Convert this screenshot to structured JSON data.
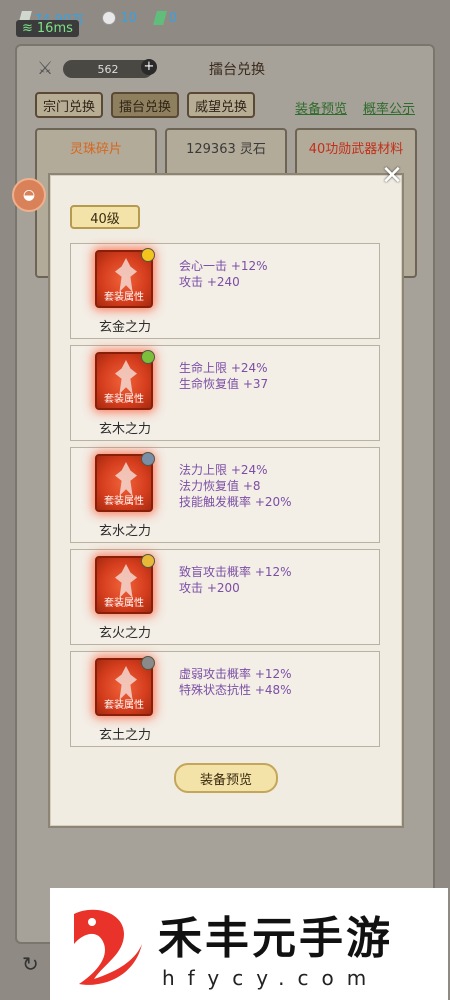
{
  "resources": {
    "spirit": "74.90万",
    "pearl": "10",
    "jade": "0",
    "ping": "16ms"
  },
  "panel": {
    "counter": "562",
    "title": "擂台兑换"
  },
  "tabs": [
    "宗门兑换",
    "擂台兑换",
    "威望兑换"
  ],
  "links": [
    "装备预览",
    "概率公示"
  ],
  "shop_cards": [
    "灵珠碎片",
    "129363 灵石",
    "40功勋武器材料"
  ],
  "modal": {
    "level": "40级",
    "sets": [
      {
        "name": "玄金之力",
        "badge_color": "#f2c41c",
        "attrs": [
          "会心一击 +12%",
          "攻击 +240"
        ]
      },
      {
        "name": "玄木之力",
        "badge_color": "#7bbf3a",
        "attrs": [
          "生命上限 +24%",
          "生命恢复值 +37"
        ]
      },
      {
        "name": "玄水之力",
        "badge_color": "#7a8fa6",
        "attrs": [
          "法力上限 +24%",
          "法力恢复值 +8",
          "技能触发概率 +20%"
        ]
      },
      {
        "name": "玄火之力",
        "badge_color": "#e8b838",
        "attrs": [
          "致盲攻击概率 +12%",
          "攻击 +200"
        ]
      },
      {
        "name": "玄土之力",
        "badge_color": "#8a8a8a",
        "attrs": [
          "虚弱攻击概率 +12%",
          "特殊状态抗性 +48%"
        ]
      }
    ],
    "icon_label": "套装属性",
    "preview_button": "装备预览"
  },
  "watermark": {
    "brand": "禾丰元手游",
    "url": "hfycy.com"
  }
}
